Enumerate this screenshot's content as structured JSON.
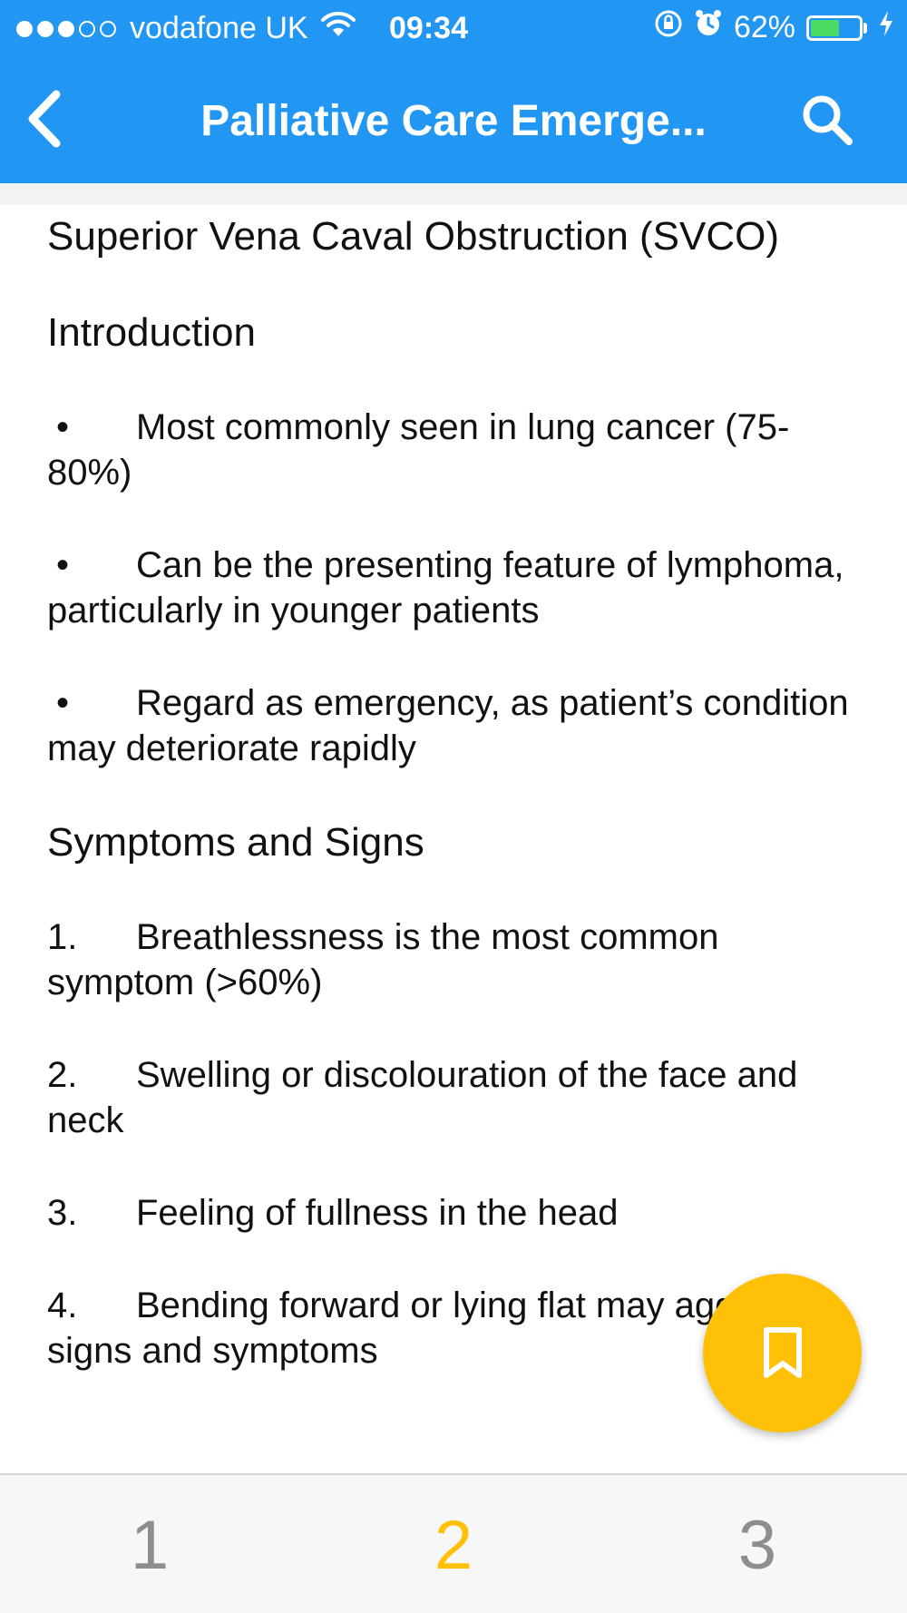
{
  "status_bar": {
    "carrier": "vodafone UK",
    "time": "09:34",
    "battery_percent": "62%",
    "battery_level": 0.62,
    "signal_bars_filled": 3,
    "signal_bars_total": 5,
    "battery_color": "#4CD964"
  },
  "nav": {
    "title": "Palliative Care Emerge...",
    "back_icon": "chevron-left-icon",
    "search_icon": "search-icon",
    "color": "#2196F3"
  },
  "content": {
    "title": "Superior Vena Caval Obstruction (SVCO)",
    "introduction": {
      "heading": "Introduction",
      "bullets": [
        {
          "marker": "•",
          "text": "Most commonly seen in lung cancer (75-80%)"
        },
        {
          "marker": "•",
          "text": "Can be the presenting feature of lymphoma, particularly in younger patients"
        },
        {
          "marker": "•",
          "text": "Regard as emergency, as patient’s condition may deteriorate rapidly"
        }
      ]
    },
    "symptoms": {
      "heading": "Symptoms and Signs",
      "items": [
        {
          "marker": "1.",
          "text": "Breathlessness is the most common symptom (>60%)"
        },
        {
          "marker": "2.",
          "text": "Swelling or discolouration of the face and neck"
        },
        {
          "marker": "3.",
          "text": "Feeling of fullness in the head"
        },
        {
          "marker": "4.",
          "text": "Bending forward or lying flat may aggravate signs and symptoms"
        }
      ]
    }
  },
  "fab": {
    "icon": "bookmark-icon",
    "color": "#FFC107"
  },
  "pagination": {
    "tabs": [
      {
        "label": "1",
        "active": false
      },
      {
        "label": "2",
        "active": true
      },
      {
        "label": "3",
        "active": false
      }
    ],
    "active_color": "#FFC107",
    "inactive_color": "#8e8e8e"
  }
}
